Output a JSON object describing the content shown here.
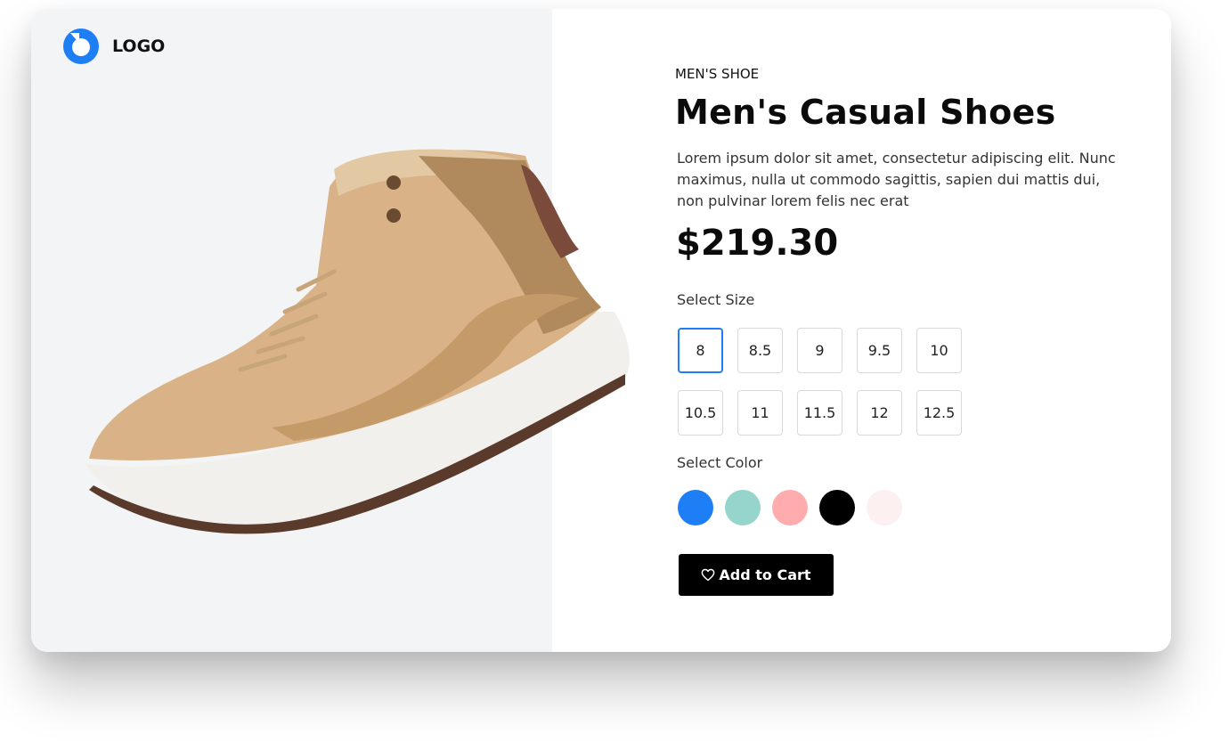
{
  "brand": {
    "logo_text": "LOGO",
    "accent": "#1e7ef6"
  },
  "product": {
    "category": "MEN'S SHOE",
    "title": "Men's Casual Shoes",
    "description": "Lorem ipsum dolor sit amet, consectetur adipiscing elit. Nunc maximus, nulla ut commodo sagittis, sapien dui mattis dui, non pulvinar lorem felis nec erat",
    "price": "$219.30",
    "image_icon": "shoe-image"
  },
  "size": {
    "label": "Select Size",
    "selected": "8",
    "options": [
      "8",
      "8.5",
      "9",
      "9.5",
      "10",
      "10.5",
      "11",
      "11.5",
      "12",
      "12.5"
    ]
  },
  "color": {
    "label": "Select Color",
    "options": [
      "#1e7ef6",
      "#95d5cb",
      "#ffacae",
      "#000000",
      "#fdf0f0"
    ]
  },
  "cart": {
    "label": "Add to Cart",
    "icon": "heart-icon"
  }
}
